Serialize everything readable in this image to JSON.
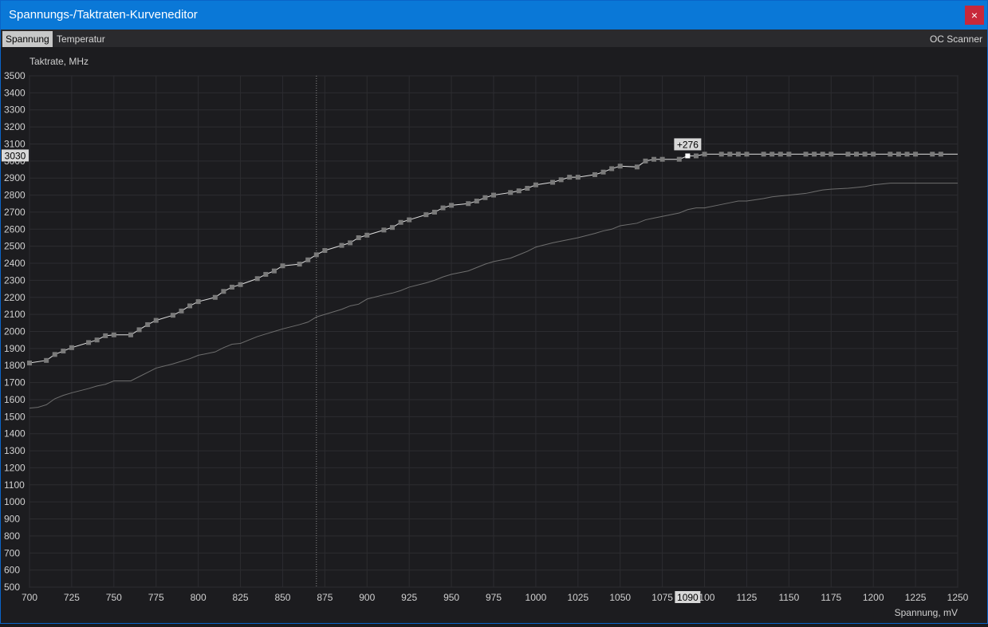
{
  "window": {
    "title": "Spannungs-/Taktraten-Kurveneditor",
    "close_label": "×"
  },
  "tabs": [
    {
      "label": "Spannung",
      "active": true
    },
    {
      "label": "Temperatur",
      "active": false
    }
  ],
  "toolbar": {
    "oc_scanner_label": "OC Scanner"
  },
  "colors": {
    "titlebar": "#0a78d7",
    "close": "#c8283a",
    "background": "#1c1c1f",
    "curve": "#e0e0e0",
    "base_curve": "#6e6e6e",
    "marker": "#7a7a7a",
    "grid": "#2c2c30"
  },
  "chart_data": {
    "type": "line",
    "xlabel": "Spannung, mV",
    "ylabel": "Taktrate, MHz",
    "xlim": [
      700,
      1250
    ],
    "ylim": [
      500,
      3500
    ],
    "x_ticks": [
      700,
      725,
      750,
      775,
      800,
      825,
      850,
      875,
      900,
      925,
      950,
      975,
      1000,
      1025,
      1050,
      1075,
      1100,
      1125,
      1150,
      1175,
      1200,
      1225,
      1250
    ],
    "y_ticks": [
      500,
      600,
      700,
      800,
      900,
      1000,
      1100,
      1200,
      1300,
      1400,
      1500,
      1600,
      1700,
      1800,
      1900,
      2000,
      2100,
      2200,
      2300,
      2400,
      2500,
      2600,
      2700,
      2800,
      2900,
      3000,
      3100,
      3200,
      3300,
      3400,
      3500
    ],
    "cursor": {
      "x": 870,
      "x_label": "",
      "y_label": ""
    },
    "selected_point": {
      "x": 1090,
      "y": 3030,
      "x_label": "1090",
      "y_label": "3030",
      "offset_label": "+276"
    },
    "series": [
      {
        "role": "adjusted",
        "x": [
          700,
          710,
          715,
          720,
          725,
          735,
          740,
          745,
          750,
          760,
          765,
          770,
          775,
          785,
          790,
          795,
          800,
          810,
          815,
          820,
          825,
          835,
          840,
          845,
          850,
          860,
          865,
          870,
          875,
          885,
          890,
          895,
          900,
          910,
          915,
          920,
          925,
          935,
          940,
          945,
          950,
          960,
          965,
          970,
          975,
          985,
          990,
          995,
          1000,
          1010,
          1015,
          1020,
          1025,
          1035,
          1040,
          1045,
          1050,
          1060,
          1065,
          1070,
          1075,
          1085,
          1090,
          1095,
          1100,
          1110,
          1115,
          1120,
          1125,
          1135,
          1140,
          1145,
          1150,
          1160,
          1165,
          1170,
          1175,
          1185,
          1190,
          1195,
          1200,
          1210,
          1215,
          1220,
          1225,
          1235,
          1240,
          1250
        ],
        "y": [
          1815,
          1830,
          1865,
          1885,
          1905,
          1935,
          1950,
          1975,
          1980,
          1980,
          2010,
          2040,
          2065,
          2095,
          2120,
          2150,
          2175,
          2200,
          2235,
          2260,
          2275,
          2310,
          2335,
          2355,
          2385,
          2395,
          2420,
          2450,
          2475,
          2505,
          2520,
          2550,
          2565,
          2595,
          2610,
          2640,
          2655,
          2685,
          2700,
          2725,
          2740,
          2750,
          2765,
          2785,
          2800,
          2815,
          2825,
          2840,
          2860,
          2875,
          2890,
          2905,
          2905,
          2920,
          2935,
          2955,
          2970,
          2965,
          3000,
          3010,
          3010,
          3010,
          3030,
          3030,
          3040,
          3040,
          3040,
          3040,
          3040,
          3040,
          3040,
          3040,
          3040,
          3040,
          3040,
          3040,
          3040,
          3040,
          3040,
          3040,
          3040,
          3040,
          3040,
          3040,
          3040,
          3040,
          3040,
          3040
        ],
        "markers": true
      },
      {
        "role": "base",
        "x": [
          700,
          705,
          710,
          715,
          720,
          725,
          735,
          740,
          745,
          750,
          760,
          765,
          770,
          775,
          785,
          790,
          795,
          800,
          810,
          815,
          820,
          825,
          835,
          840,
          845,
          850,
          860,
          865,
          870,
          875,
          885,
          890,
          895,
          900,
          910,
          915,
          920,
          925,
          935,
          940,
          945,
          950,
          960,
          965,
          970,
          975,
          985,
          990,
          995,
          1000,
          1010,
          1015,
          1020,
          1025,
          1035,
          1040,
          1045,
          1050,
          1060,
          1065,
          1070,
          1075,
          1085,
          1090,
          1095,
          1100,
          1110,
          1115,
          1120,
          1125,
          1135,
          1140,
          1145,
          1150,
          1160,
          1165,
          1170,
          1175,
          1185,
          1190,
          1195,
          1200,
          1210,
          1215,
          1220,
          1225,
          1235,
          1240,
          1250
        ],
        "y": [
          1550,
          1555,
          1570,
          1605,
          1625,
          1640,
          1665,
          1680,
          1690,
          1710,
          1710,
          1735,
          1760,
          1785,
          1810,
          1825,
          1840,
          1860,
          1880,
          1905,
          1925,
          1930,
          1970,
          1985,
          2000,
          2015,
          2040,
          2055,
          2085,
          2100,
          2130,
          2150,
          2160,
          2190,
          2215,
          2225,
          2240,
          2260,
          2285,
          2300,
          2320,
          2335,
          2355,
          2375,
          2395,
          2410,
          2430,
          2450,
          2470,
          2495,
          2520,
          2530,
          2540,
          2550,
          2575,
          2590,
          2600,
          2620,
          2635,
          2655,
          2665,
          2675,
          2695,
          2715,
          2725,
          2725,
          2745,
          2755,
          2765,
          2765,
          2780,
          2790,
          2795,
          2800,
          2810,
          2820,
          2830,
          2835,
          2840,
          2845,
          2850,
          2860,
          2870,
          2870,
          2870,
          2870,
          2870,
          2870,
          2870
        ]
      }
    ]
  }
}
